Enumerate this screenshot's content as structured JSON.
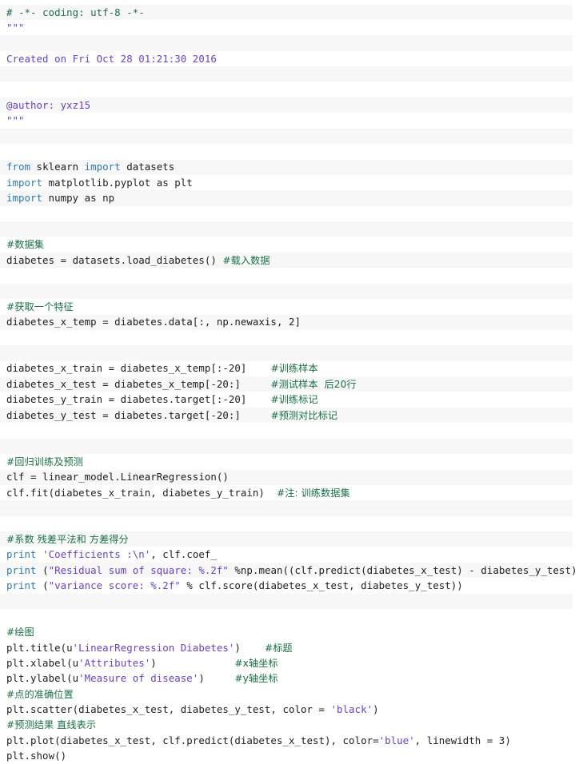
{
  "editor": {
    "language": "Python",
    "background_color": "#ffffff",
    "stripe_color": "#f7f7f7",
    "colors": {
      "keyword": "#2b7bba",
      "string": "#6a3fd4",
      "comment": "#177245",
      "plain_text": "#202020"
    }
  },
  "code": {
    "lines": [
      {
        "n": 1,
        "segments": [
          {
            "t": "cmt",
            "s": "# -*- coding: utf-8 -*-"
          }
        ]
      },
      {
        "n": 2,
        "segments": [
          {
            "t": "str",
            "s": "\"\"\""
          }
        ]
      },
      {
        "n": 3,
        "segments": []
      },
      {
        "n": 4,
        "segments": [
          {
            "t": "str",
            "s": "Created on Fri Oct 28 01:21:30 2016"
          }
        ]
      },
      {
        "n": 5,
        "segments": []
      },
      {
        "n": 6,
        "segments": []
      },
      {
        "n": 7,
        "segments": [
          {
            "t": "str",
            "s": "@author: yxz15"
          }
        ]
      },
      {
        "n": 8,
        "segments": [
          {
            "t": "str",
            "s": "\"\"\""
          }
        ]
      },
      {
        "n": 9,
        "segments": []
      },
      {
        "n": 10,
        "segments": []
      },
      {
        "n": 11,
        "segments": [
          {
            "t": "kw",
            "s": "from"
          },
          {
            "t": "plain",
            "s": " sklearn "
          },
          {
            "t": "kw",
            "s": "import"
          },
          {
            "t": "plain",
            "s": " datasets"
          }
        ]
      },
      {
        "n": 12,
        "segments": [
          {
            "t": "kw",
            "s": "import"
          },
          {
            "t": "plain",
            "s": " matplotlib.pyplot as plt"
          }
        ]
      },
      {
        "n": 13,
        "segments": [
          {
            "t": "kw",
            "s": "import"
          },
          {
            "t": "plain",
            "s": " numpy as np"
          }
        ]
      },
      {
        "n": 14,
        "segments": []
      },
      {
        "n": 15,
        "segments": []
      },
      {
        "n": 16,
        "segments": [
          {
            "t": "cmt-cn",
            "s": "#数据集"
          }
        ]
      },
      {
        "n": 17,
        "segments": [
          {
            "t": "plain",
            "s": "diabetes = datasets.load_diabetes() "
          },
          {
            "t": "cmt-cn",
            "s": "#载入数据"
          }
        ]
      },
      {
        "n": 18,
        "segments": []
      },
      {
        "n": 19,
        "segments": []
      },
      {
        "n": 20,
        "segments": [
          {
            "t": "cmt-cn",
            "s": "#获取一个特征"
          }
        ]
      },
      {
        "n": 21,
        "segments": [
          {
            "t": "plain",
            "s": "diabetes_x_temp = diabetes.data[:, np.newaxis, 2]"
          }
        ]
      },
      {
        "n": 22,
        "segments": []
      },
      {
        "n": 23,
        "segments": []
      },
      {
        "n": 24,
        "segments": [
          {
            "t": "plain",
            "s": "diabetes_x_train = diabetes_x_temp[:-20]    "
          },
          {
            "t": "cmt-cn",
            "s": "#训练样本"
          }
        ]
      },
      {
        "n": 25,
        "segments": [
          {
            "t": "plain",
            "s": "diabetes_x_test = diabetes_x_temp[-20:]     "
          },
          {
            "t": "cmt-cn",
            "s": "#测试样本  后20行"
          }
        ]
      },
      {
        "n": 26,
        "segments": [
          {
            "t": "plain",
            "s": "diabetes_y_train = diabetes.target[:-20]    "
          },
          {
            "t": "cmt-cn",
            "s": "#训练标记"
          }
        ]
      },
      {
        "n": 27,
        "segments": [
          {
            "t": "plain",
            "s": "diabetes_y_test = diabetes.target[-20:]     "
          },
          {
            "t": "cmt-cn",
            "s": "#预测对比标记"
          }
        ]
      },
      {
        "n": 28,
        "segments": []
      },
      {
        "n": 29,
        "segments": []
      },
      {
        "n": 30,
        "segments": [
          {
            "t": "cmt-cn",
            "s": "#回归训练及预测"
          }
        ]
      },
      {
        "n": 31,
        "segments": [
          {
            "t": "plain",
            "s": "clf = linear_model.LinearRegression()"
          }
        ]
      },
      {
        "n": 32,
        "segments": [
          {
            "t": "plain",
            "s": "clf.fit(diabetes_x_train, diabetes_y_train)  "
          },
          {
            "t": "cmt-cn",
            "s": "#注: 训练数据集"
          }
        ]
      },
      {
        "n": 33,
        "segments": []
      },
      {
        "n": 34,
        "segments": []
      },
      {
        "n": 35,
        "segments": [
          {
            "t": "cmt-cn",
            "s": "#系数 残差平法和 方差得分"
          }
        ]
      },
      {
        "n": 36,
        "segments": [
          {
            "t": "kw",
            "s": "print"
          },
          {
            "t": "plain",
            "s": " "
          },
          {
            "t": "str",
            "s": "'Coefficients :\\n'"
          },
          {
            "t": "plain",
            "s": ", clf.coef_"
          }
        ]
      },
      {
        "n": 37,
        "segments": [
          {
            "t": "kw",
            "s": "print"
          },
          {
            "t": "plain",
            "s": " ("
          },
          {
            "t": "str",
            "s": "\"Residual sum of square: %.2f\""
          },
          {
            "t": "plain",
            "s": " %np.mean((clf.predict(diabetes_x_test) - diabetes_y_test) **"
          }
        ]
      },
      {
        "n": 38,
        "segments": [
          {
            "t": "kw",
            "s": "print"
          },
          {
            "t": "plain",
            "s": " ("
          },
          {
            "t": "str",
            "s": "\"variance score: %.2f\""
          },
          {
            "t": "plain",
            "s": " % clf.score(diabetes_x_test, diabetes_y_test))"
          }
        ]
      },
      {
        "n": 39,
        "segments": []
      },
      {
        "n": 40,
        "segments": []
      },
      {
        "n": 41,
        "segments": [
          {
            "t": "cmt-cn",
            "s": "#绘图"
          }
        ]
      },
      {
        "n": 42,
        "segments": [
          {
            "t": "plain",
            "s": "plt.title(u"
          },
          {
            "t": "str",
            "s": "'LinearRegression Diabetes'"
          },
          {
            "t": "plain",
            "s": ")    "
          },
          {
            "t": "cmt-cn",
            "s": "#标题"
          }
        ]
      },
      {
        "n": 43,
        "segments": [
          {
            "t": "plain",
            "s": "plt.xlabel(u"
          },
          {
            "t": "str",
            "s": "'Attributes'"
          },
          {
            "t": "plain",
            "s": ")             "
          },
          {
            "t": "cmt-cn",
            "s": "#x轴坐标"
          }
        ]
      },
      {
        "n": 44,
        "segments": [
          {
            "t": "plain",
            "s": "plt.ylabel(u"
          },
          {
            "t": "str",
            "s": "'Measure of disease'"
          },
          {
            "t": "plain",
            "s": ")     "
          },
          {
            "t": "cmt-cn",
            "s": "#y轴坐标"
          }
        ]
      },
      {
        "n": 45,
        "segments": [
          {
            "t": "cmt-cn",
            "s": "#点的准确位置"
          }
        ]
      },
      {
        "n": 46,
        "segments": [
          {
            "t": "plain",
            "s": "plt.scatter(diabetes_x_test, diabetes_y_test, color = "
          },
          {
            "t": "str",
            "s": "'black'"
          },
          {
            "t": "plain",
            "s": ")"
          }
        ]
      },
      {
        "n": 47,
        "segments": [
          {
            "t": "cmt-cn",
            "s": "#预测结果 直线表示"
          }
        ]
      },
      {
        "n": 48,
        "segments": [
          {
            "t": "plain",
            "s": "plt.plot(diabetes_x_test, clf.predict(diabetes_x_test), color="
          },
          {
            "t": "str",
            "s": "'blue'"
          },
          {
            "t": "plain",
            "s": ", linewidth = 3)"
          }
        ]
      },
      {
        "n": 49,
        "segments": [
          {
            "t": "plain",
            "s": "plt.show()"
          }
        ]
      }
    ]
  }
}
